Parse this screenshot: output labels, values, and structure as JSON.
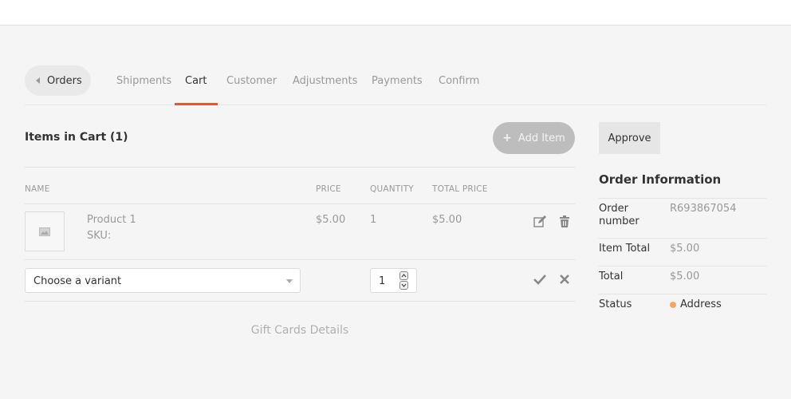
{
  "nav": {
    "back_label": "Orders",
    "tabs": [
      {
        "label": "Shipments"
      },
      {
        "label": "Cart"
      },
      {
        "label": "Customer"
      },
      {
        "label": "Adjustments"
      },
      {
        "label": "Payments"
      },
      {
        "label": "Confirm"
      }
    ],
    "active_tab": "Cart",
    "accent_color": "#e5582e"
  },
  "cart": {
    "title": "Items in Cart (1)",
    "add_item_label": "Add Item",
    "columns": [
      "NAME",
      "PRICE",
      "QUANTITY",
      "TOTAL PRICE"
    ],
    "items": [
      {
        "name": "Product 1",
        "sku_label": "SKU:",
        "price": "$5.00",
        "quantity": "1",
        "total_price": "$5.00",
        "thumbnail_icon": "image-placeholder-icon",
        "actions": [
          "edit-icon",
          "trash-icon"
        ]
      }
    ],
    "new_line": {
      "variant_placeholder": "Choose a variant",
      "quantity": "1",
      "actions": [
        "check-icon",
        "close-icon"
      ]
    },
    "gift_cards_label": "Gift Cards Details"
  },
  "sidebar": {
    "approve_label": "Approve",
    "order_info_title": "Order Information",
    "rows": [
      {
        "label": "Order number",
        "value": "R693867054"
      },
      {
        "label": "Item Total",
        "value": "$5.00"
      },
      {
        "label": "Total",
        "value": "$5.00"
      },
      {
        "label": "Status",
        "value": "Address",
        "status_color": "#f5a761"
      }
    ]
  }
}
